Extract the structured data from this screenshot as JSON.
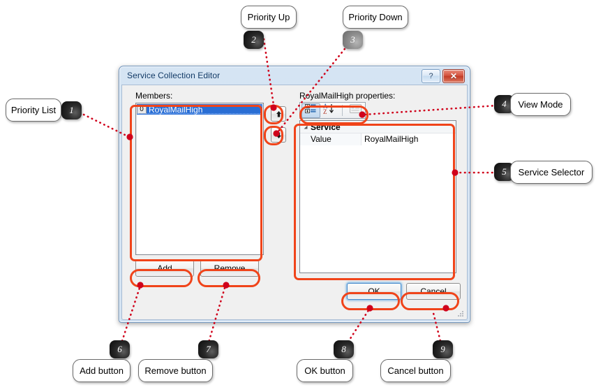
{
  "dialog": {
    "title": "Service Collection Editor",
    "help_label": "?",
    "close_label": "✕",
    "members_label": "Members:",
    "properties_label": "RoyalMailHigh properties:",
    "members": [
      {
        "index": "0",
        "name": "RoyalMailHigh",
        "selected": true
      }
    ],
    "move_up_icon": "arrow-up-icon",
    "move_down_icon": "arrow-down-icon",
    "prop_toolbar": [
      {
        "name": "categorized-view-icon",
        "state": "active"
      },
      {
        "name": "alphabetical-sort-icon",
        "state": "normal"
      },
      {
        "name": "property-pages-icon",
        "state": "disabled"
      }
    ],
    "property_grid": {
      "category": "Service",
      "expander": "▲",
      "rows": [
        {
          "name": "Value",
          "value": "RoyalMailHigh"
        }
      ]
    },
    "buttons": {
      "add": "Add",
      "remove": "Remove",
      "ok": "OK",
      "cancel": "Cancel"
    }
  },
  "annotations": {
    "accent_color": "#f0441a",
    "connector_color": "#d0021b",
    "items": [
      {
        "number": "1",
        "label": "Priority List",
        "badge_style": "dark"
      },
      {
        "number": "2",
        "label": "Priority Up",
        "badge_style": "dark"
      },
      {
        "number": "3",
        "label": "Priority Down",
        "badge_style": "light"
      },
      {
        "number": "4",
        "label": "View Mode",
        "badge_style": "dark"
      },
      {
        "number": "5",
        "label": "Service Selector",
        "badge_style": "dark"
      },
      {
        "number": "6",
        "label": "Add button",
        "badge_style": "dark"
      },
      {
        "number": "7",
        "label": "Remove button",
        "badge_style": "dark"
      },
      {
        "number": "8",
        "label": "OK button",
        "badge_style": "dark"
      },
      {
        "number": "9",
        "label": "Cancel button",
        "badge_style": "dark"
      }
    ]
  }
}
